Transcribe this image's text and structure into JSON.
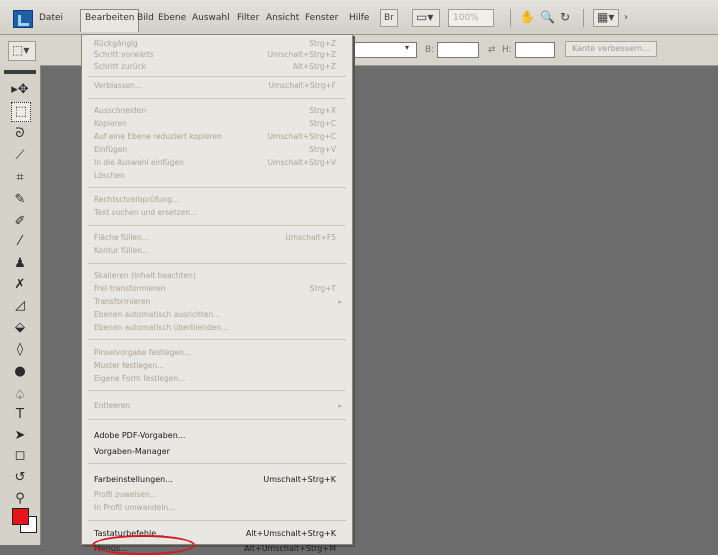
{
  "menubar": {
    "items": [
      "Datei",
      "Bearbeiten",
      "Bild",
      "Ebene",
      "Auswahl",
      "Filter",
      "Ansicht",
      "Fenster",
      "Hilfe"
    ],
    "zoom": "100%",
    "search_button": "Suche"
  },
  "options": {
    "width_label": "B:",
    "height_label": "H:",
    "refine_edge_button": "Kante verbessern..."
  },
  "edit_menu": {
    "items": [
      {
        "label": "Rückgängig",
        "shortcut": "Strg+Z",
        "enabled": false
      },
      {
        "label": "Schritt vorwärts",
        "shortcut": "Umschalt+Strg+Z",
        "enabled": false
      },
      {
        "label": "Schritt zurück",
        "shortcut": "Alt+Strg+Z",
        "enabled": false
      },
      {
        "label": "Verblassen...",
        "shortcut": "Umschalt+Strg+F",
        "enabled": false
      },
      {
        "label": "Ausschneiden",
        "shortcut": "Strg+X",
        "enabled": false
      },
      {
        "label": "Kopieren",
        "shortcut": "Strg+C",
        "enabled": false
      },
      {
        "label": "Auf eine Ebene reduziert kopieren",
        "shortcut": "Umschalt+Strg+C",
        "enabled": false
      },
      {
        "label": "Einfügen",
        "shortcut": "Strg+V",
        "enabled": false
      },
      {
        "label": "In die Auswahl einfügen",
        "shortcut": "Umschalt+Strg+V",
        "enabled": false
      },
      {
        "label": "Löschen",
        "shortcut": "",
        "enabled": false
      },
      {
        "label": "Rechtschreibprüfung...",
        "shortcut": "",
        "enabled": false
      },
      {
        "label": "Text suchen und ersetzen...",
        "shortcut": "",
        "enabled": false
      },
      {
        "label": "Fläche füllen...",
        "shortcut": "Umschalt+F5",
        "enabled": false
      },
      {
        "label": "Kontur füllen...",
        "shortcut": "",
        "enabled": false
      },
      {
        "label": "Skalieren (Inhalt beachten)",
        "shortcut": "",
        "enabled": false
      },
      {
        "label": "Frei transformieren",
        "shortcut": "Strg+T",
        "enabled": false
      },
      {
        "label": "Transformieren",
        "shortcut": "",
        "enabled": false,
        "submenu": true
      },
      {
        "label": "Ebenen automatisch ausrichten...",
        "shortcut": "",
        "enabled": false
      },
      {
        "label": "Ebenen automatisch überblenden...",
        "shortcut": "",
        "enabled": false
      },
      {
        "label": "Pinselvorgabe festlegen...",
        "shortcut": "",
        "enabled": false
      },
      {
        "label": "Muster festlegen...",
        "shortcut": "",
        "enabled": false
      },
      {
        "label": "Eigene Form festlegen...",
        "shortcut": "",
        "enabled": false
      },
      {
        "label": "Entleeren",
        "shortcut": "",
        "enabled": false,
        "submenu": true
      },
      {
        "label": "Adobe PDF-Vorgaben...",
        "shortcut": "",
        "enabled": true
      },
      {
        "label": "Vorgaben-Manager",
        "shortcut": "",
        "enabled": true
      },
      {
        "label": "Farbeinstellungen...",
        "shortcut": "Umschalt+Strg+K",
        "enabled": true
      },
      {
        "label": "Profil zuweisen...",
        "shortcut": "",
        "enabled": false
      },
      {
        "label": "In Profil umwandeln...",
        "shortcut": "",
        "enabled": false
      },
      {
        "label": "Tastaturbefehle...",
        "shortcut": "Alt+Umschalt+Strg+K",
        "enabled": true
      },
      {
        "label": "Menüs...",
        "shortcut": "Alt+Umschalt+Strg+M",
        "enabled": true
      }
    ]
  },
  "colors": {
    "foreground": "#e8141c",
    "background": "#ffffff",
    "highlight": "#d61a20",
    "workspace": "#6c6c6c"
  }
}
